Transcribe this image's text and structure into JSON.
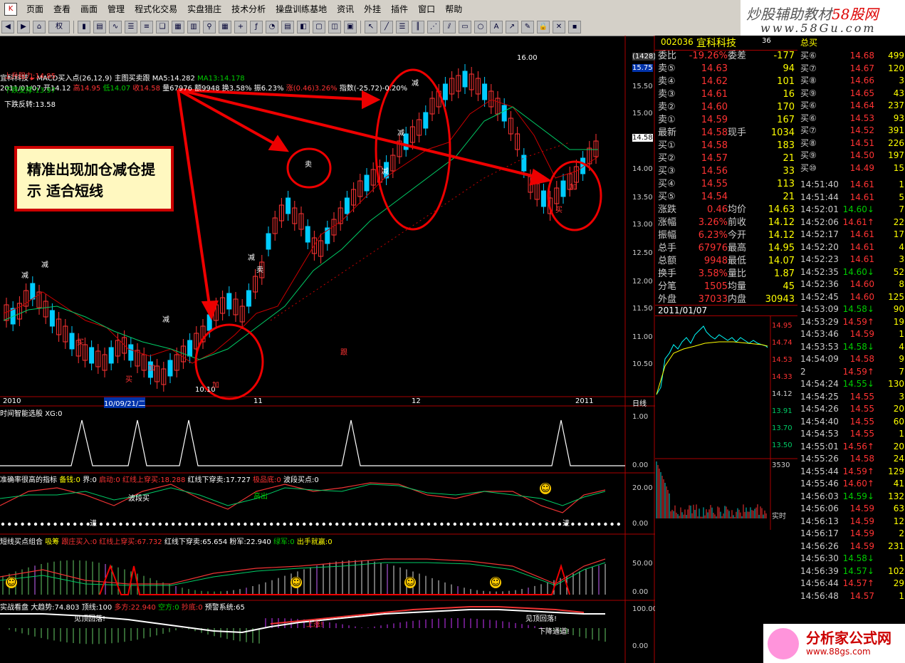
{
  "menu": {
    "items": [
      "页面",
      "查看",
      "画面",
      "管理",
      "程式化交易",
      "实盘猎庄",
      "技术分析",
      "操盘训练基地",
      "资讯",
      "外挂",
      "插件",
      "窗口",
      "帮助"
    ]
  },
  "toolbar": {
    "period": "权"
  },
  "brand": {
    "line1": "炒股辅助教材",
    "line1_red": "58股网",
    "line2": "www.58Gu.com"
  },
  "chart": {
    "stock_name": "宜科科技",
    "indicator_header": "MACD买入点(26,12,9)  主图买卖跟",
    "ma5": "MA5:14.282",
    "ma13": "MA13:14.178",
    "ohlc": {
      "date": "2011/01/07",
      "open": "开14.12",
      "high": "高14.95",
      "low": "低14.07",
      "close": "收14.58",
      "volume": "量67976",
      "amount": "额9948",
      "turnover": "换3.58%",
      "amplitude": "振6.23%",
      "change": "涨(0.46)3.26%",
      "index": "指数(-25.72)-0.20%"
    },
    "levels": {
      "resist": "上升阻力:14.85",
      "support": "下跌支撑:13.97",
      "reverse": "下跌反转:13.58"
    },
    "callout": "精准出现加仓减仓提示 适合短线",
    "price_axis": [
      "15.75",
      "15.50",
      "15.00",
      "14.50",
      "14.00",
      "13.50",
      "13.00",
      "12.50",
      "12.00",
      "11.50",
      "11.00",
      "10.50"
    ],
    "current_price_tag": "14.58",
    "count_tag": "(1428)",
    "hi_label": "16.00",
    "lo_label": "10.10",
    "date_axis": {
      "y2010": "2010",
      "cursor": "10/09/21/二",
      "nov": "11",
      "dec": "12",
      "y2011": "2011",
      "period": "日线"
    },
    "marks": {
      "jian": "减",
      "mai": "卖",
      "jia": "加",
      "mai_buy": "买",
      "gen": "跟"
    }
  },
  "panel1": {
    "title": "时间智能选股",
    "xg": "XG:0",
    "axis": [
      "1.00",
      "0.00"
    ]
  },
  "panel2": {
    "title": "准确率很高的指标",
    "beiqian": "备钱:0",
    "jie": "界:0",
    "qidong": "启动:0",
    "hongxian_up": "红线上穿买:18.288",
    "hongxian_down": "红线下穿卖:17.727",
    "jipin": "极品底:0",
    "boduan": "波段买点:0",
    "axis": [
      "20.00",
      "0.00"
    ],
    "boduan_label": "波段买",
    "jin": "进",
    "chu": "高出"
  },
  "panel3": {
    "title": "短线买点组合",
    "xichou": "吸筹",
    "genzhuang": "跟庄买入:0",
    "hong_up": "红线上穿买:67.732",
    "hong_down": "红线下穿卖:65.654",
    "fenjun": "粉军:22.940",
    "lvjun": "绿军:0",
    "chushou": "出手就赢:0",
    "axis": [
      "50.00",
      "0.00"
    ]
  },
  "panel4": {
    "title": "实战看盘",
    "dqs": "大趋势:74.803",
    "qd": "顶线:100",
    "duofang": "多方:22.940",
    "kongfang": "空方:0",
    "chaodi": "抄底:0",
    "yujing": "预警系统:65",
    "axis": [
      "100.00",
      "0.00"
    ],
    "t1": "见顶回落!",
    "t2": "上涨!",
    "t3": "见顶回落!",
    "t4": "下降通道!"
  },
  "quote": {
    "code": "002036",
    "name": "宜科科技",
    "badge": "36",
    "webi": {
      "k": "委比",
      "p": "-19.26%",
      "k2": "委差",
      "v": "-177"
    },
    "asks": [
      {
        "k": "卖⑤",
        "p": "14.63",
        "v": "94"
      },
      {
        "k": "卖④",
        "p": "14.62",
        "v": "101"
      },
      {
        "k": "卖③",
        "p": "14.61",
        "v": "16"
      },
      {
        "k": "卖②",
        "p": "14.60",
        "v": "170"
      },
      {
        "k": "卖①",
        "p": "14.59",
        "v": "167"
      }
    ],
    "last": {
      "k": "最新",
      "p": "14.58",
      "k2": "现手",
      "v": "1034"
    },
    "bids": [
      {
        "k": "买①",
        "p": "14.58",
        "v": "183"
      },
      {
        "k": "买②",
        "p": "14.57",
        "v": "21"
      },
      {
        "k": "买③",
        "p": "14.56",
        "v": "33"
      },
      {
        "k": "买④",
        "p": "14.55",
        "v": "113"
      },
      {
        "k": "买⑤",
        "p": "14.54",
        "v": "21"
      }
    ],
    "stats": [
      {
        "k": "涨跌",
        "p": "0.46",
        "k2": "均价",
        "v": "14.63"
      },
      {
        "k": "涨幅",
        "p": "3.26%",
        "k2": "前收",
        "v": "14.12"
      },
      {
        "k": "振幅",
        "p": "6.23%",
        "k2": "今开",
        "v": "14.12"
      },
      {
        "k": "总手",
        "p": "67976",
        "k2": "最高",
        "v": "14.95"
      },
      {
        "k": "总额",
        "p": "9948",
        "k2": "最低",
        "v": "14.07"
      },
      {
        "k": "换手",
        "p": "3.58%",
        "k2": "量比",
        "v": "1.87"
      },
      {
        "k": "分笔",
        "p": "1505",
        "k2": "均量",
        "v": "45"
      },
      {
        "k": "外盘",
        "p": "37033",
        "k2": "内盘",
        "v": "30943"
      }
    ],
    "mini_date": "2011/01/07",
    "mini_axis": [
      "14.95",
      "14.74",
      "14.53",
      "14.33",
      "14.12",
      "13.91",
      "13.70",
      "13.50"
    ],
    "mini_vol": "3530",
    "mini_label": "实时"
  },
  "right": {
    "header": "总买",
    "orders": [
      {
        "k": "买⑥",
        "p": "14.68",
        "v": "499"
      },
      {
        "k": "买⑦",
        "p": "14.67",
        "v": "120"
      },
      {
        "k": "买⑧",
        "p": "14.66",
        "v": "3"
      },
      {
        "k": "买⑨",
        "p": "14.65",
        "v": "43"
      },
      {
        "k": "买⑥",
        "p": "14.64",
        "v": "237"
      },
      {
        "k": "买⑥",
        "p": "14.53",
        "v": "93"
      },
      {
        "k": "买⑦",
        "p": "14.52",
        "v": "391"
      },
      {
        "k": "买⑧",
        "p": "14.51",
        "v": "226"
      },
      {
        "k": "买⑨",
        "p": "14.50",
        "v": "197"
      },
      {
        "k": "买⑩",
        "p": "14.49",
        "v": "15"
      }
    ],
    "ticks": [
      {
        "t": "14:51:40",
        "p": "14.61",
        "v": "1"
      },
      {
        "t": "14:51:44",
        "p": "14.61",
        "v": "5"
      },
      {
        "t": "14:52:01",
        "p": "14.60↓",
        "v": "7"
      },
      {
        "t": "14:52:06",
        "p": "14.61↑",
        "v": "22"
      },
      {
        "t": "14:52:17",
        "p": "14.61",
        "v": "17"
      },
      {
        "t": "14:52:20",
        "p": "14.61",
        "v": "4"
      },
      {
        "t": "14:52:23",
        "p": "14.61",
        "v": "3"
      },
      {
        "t": "14:52:35",
        "p": "14.60↓",
        "v": "52"
      },
      {
        "t": "14:52:36",
        "p": "14.60",
        "v": "8"
      },
      {
        "t": "14:52:45",
        "p": "14.60",
        "v": "125"
      },
      {
        "t": "14:53:09",
        "p": "14.58↓",
        "v": "90"
      },
      {
        "t": "14:53:29",
        "p": "14.59↑",
        "v": "19"
      },
      {
        "t": "14:53:46",
        "p": "14.59",
        "v": "1"
      },
      {
        "t": "14:53:53",
        "p": "14.58↓",
        "v": "4"
      },
      {
        "t": "14:54:09",
        "p": "14.58",
        "v": "9"
      },
      {
        "t": "2",
        "p": "14.59↑",
        "v": "7"
      },
      {
        "t": "14:54:24",
        "p": "14.55↓",
        "v": "130"
      },
      {
        "t": "14:54:25",
        "p": "14.55",
        "v": "3"
      },
      {
        "t": "14:54:26",
        "p": "14.55",
        "v": "20"
      },
      {
        "t": "14:54:40",
        "p": "14.55",
        "v": "60"
      },
      {
        "t": "14:54:53",
        "p": "14.55",
        "v": "1"
      },
      {
        "t": "14:55:01",
        "p": "14.56↑",
        "v": "20"
      },
      {
        "t": "14:55:26",
        "p": "14.58",
        "v": "24"
      },
      {
        "t": "14:55:44",
        "p": "14.59↑",
        "v": "129"
      },
      {
        "t": "14:55:46",
        "p": "14.60↑",
        "v": "41"
      },
      {
        "t": "14:56:03",
        "p": "14.59↓",
        "v": "132"
      },
      {
        "t": "14:56:06",
        "p": "14.59",
        "v": "63"
      },
      {
        "t": "14:56:13",
        "p": "14.59",
        "v": "12"
      },
      {
        "t": "14:56:17",
        "p": "14.59",
        "v": "2"
      },
      {
        "t": "14:56:26",
        "p": "14.59",
        "v": "231"
      },
      {
        "t": "14:56:30",
        "p": "14.58↓",
        "v": "1"
      },
      {
        "t": "14:56:39",
        "p": "14.57↓",
        "v": "102"
      },
      {
        "t": "14:56:44",
        "p": "14.57↑",
        "v": "29"
      },
      {
        "t": "14:56:48",
        "p": "14.57",
        "v": "1"
      }
    ]
  },
  "ad": {
    "name": "分析家公式网",
    "url": "www.88gs.com"
  },
  "colors": {
    "up": "#ff3333",
    "down": "#00ffff",
    "ma5": "#ffffff",
    "ma13": "#00cc66",
    "annotation": "#ff0000"
  }
}
